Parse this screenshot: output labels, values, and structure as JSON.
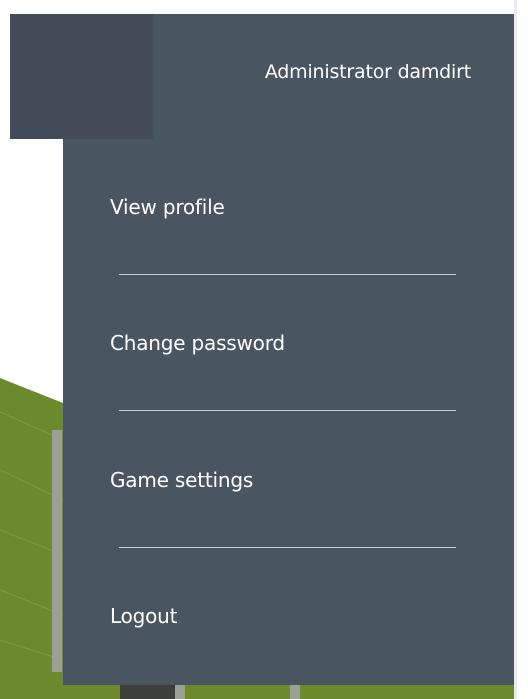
{
  "user_menu": {
    "username": "Administrator damdirt",
    "items": [
      {
        "label": "View profile"
      },
      {
        "label": "Change password"
      },
      {
        "label": "Game settings"
      },
      {
        "label": "Logout"
      }
    ]
  },
  "colors": {
    "menu_background": "#4a5562",
    "header_left_background": "#424b57",
    "text": "#ffffff",
    "divider": "#c5cbd2",
    "grass": "#6a8a2c",
    "terrain_dark": "#2f3a1e"
  }
}
